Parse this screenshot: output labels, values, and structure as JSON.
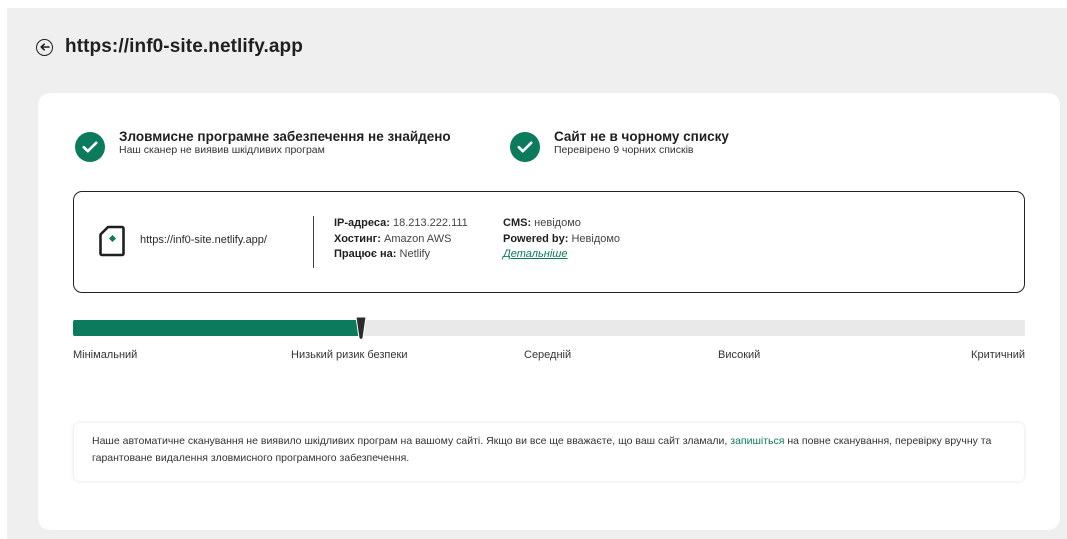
{
  "header": {
    "title": "https://inf0-site.netlify.app",
    "back_icon": "arrow-left-circle-icon"
  },
  "status": [
    {
      "title": "Зловмисне програмне забезпечення не знайдено",
      "subtitle": "Наш сканер не виявив шкідливих програм",
      "icon": "check-circle-icon"
    },
    {
      "title": "Сайт не в чорному списку",
      "subtitle": "Перевірено 9 чорних списків",
      "icon": "check-circle-icon"
    }
  ],
  "site": {
    "url": "https://inf0-site.netlify.app/",
    "icon": "file-icon",
    "ip_label": "IP-адреса:",
    "ip_value": "18.213.222.111",
    "hosting_label": "Хостинг:",
    "hosting_value": "Amazon AWS",
    "runs_label": "Працює на:",
    "runs_value": "Netlify",
    "cms_label": "CMS:",
    "cms_value": "невідомо",
    "powered_label": "Powered by:",
    "powered_value": "Невідомо",
    "details_link": "Детальніше"
  },
  "risk": {
    "level": 0.302,
    "labels": [
      "Мінімальний",
      "Низький ризик безпеки",
      "Середній",
      "Високий",
      "Критичний"
    ]
  },
  "note": {
    "text_before": "Наше автоматичне сканування не виявило шкідливих програм на вашому сайті. Якщо ви все ще вважаєте, що ваш сайт зламали,",
    "link": "запишіться",
    "text_after": "на повне сканування, перевірку вручну та гарантоване видалення зловмисного програмного забезпечення."
  },
  "colors": {
    "accent": "#0b7a5d",
    "background": "#efefef"
  }
}
